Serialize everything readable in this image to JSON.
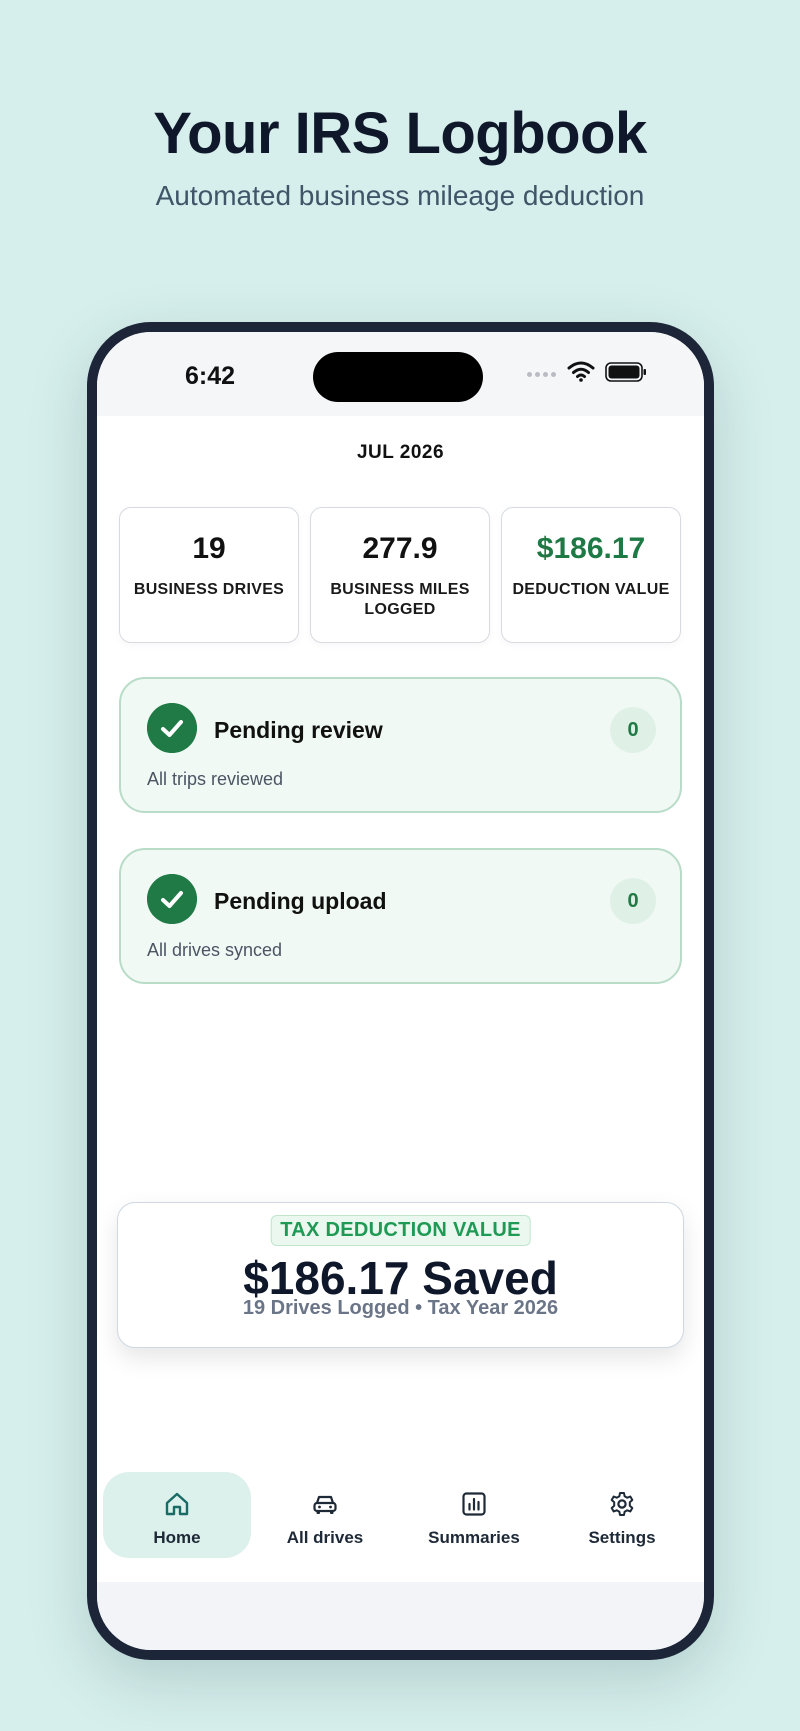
{
  "promo": {
    "headline": "Your IRS Logbook",
    "subline": "Automated business mileage deduction"
  },
  "statusbar": {
    "time": "6:42"
  },
  "month": "JUL 2026",
  "stats": [
    {
      "value": "19",
      "label": "BUSINESS DRIVES"
    },
    {
      "value": "277.9",
      "label": "BUSINESS MILES LOGGED"
    },
    {
      "value": "$186.17",
      "label": "DEDUCTION VALUE"
    }
  ],
  "cards": [
    {
      "title": "Pending review",
      "subtitle": "All trips reviewed",
      "count": "0"
    },
    {
      "title": "Pending upload",
      "subtitle": "All drives synced",
      "count": "0"
    }
  ],
  "tax": {
    "badge": "TAX DEDUCTION VALUE",
    "amount": "$186.17 Saved",
    "details": "19 Drives Logged • Tax Year 2026"
  },
  "tabs": [
    {
      "label": "Home",
      "icon": "home-icon",
      "active": true
    },
    {
      "label": "All drives",
      "icon": "car-icon",
      "active": false
    },
    {
      "label": "Summaries",
      "icon": "bar-chart-icon",
      "active": false
    },
    {
      "label": "Settings",
      "icon": "gear-icon",
      "active": false
    }
  ],
  "colors": {
    "background": "#d6efec",
    "accent_green": "#1e7a45",
    "tab_active": "#dcf0ec"
  }
}
